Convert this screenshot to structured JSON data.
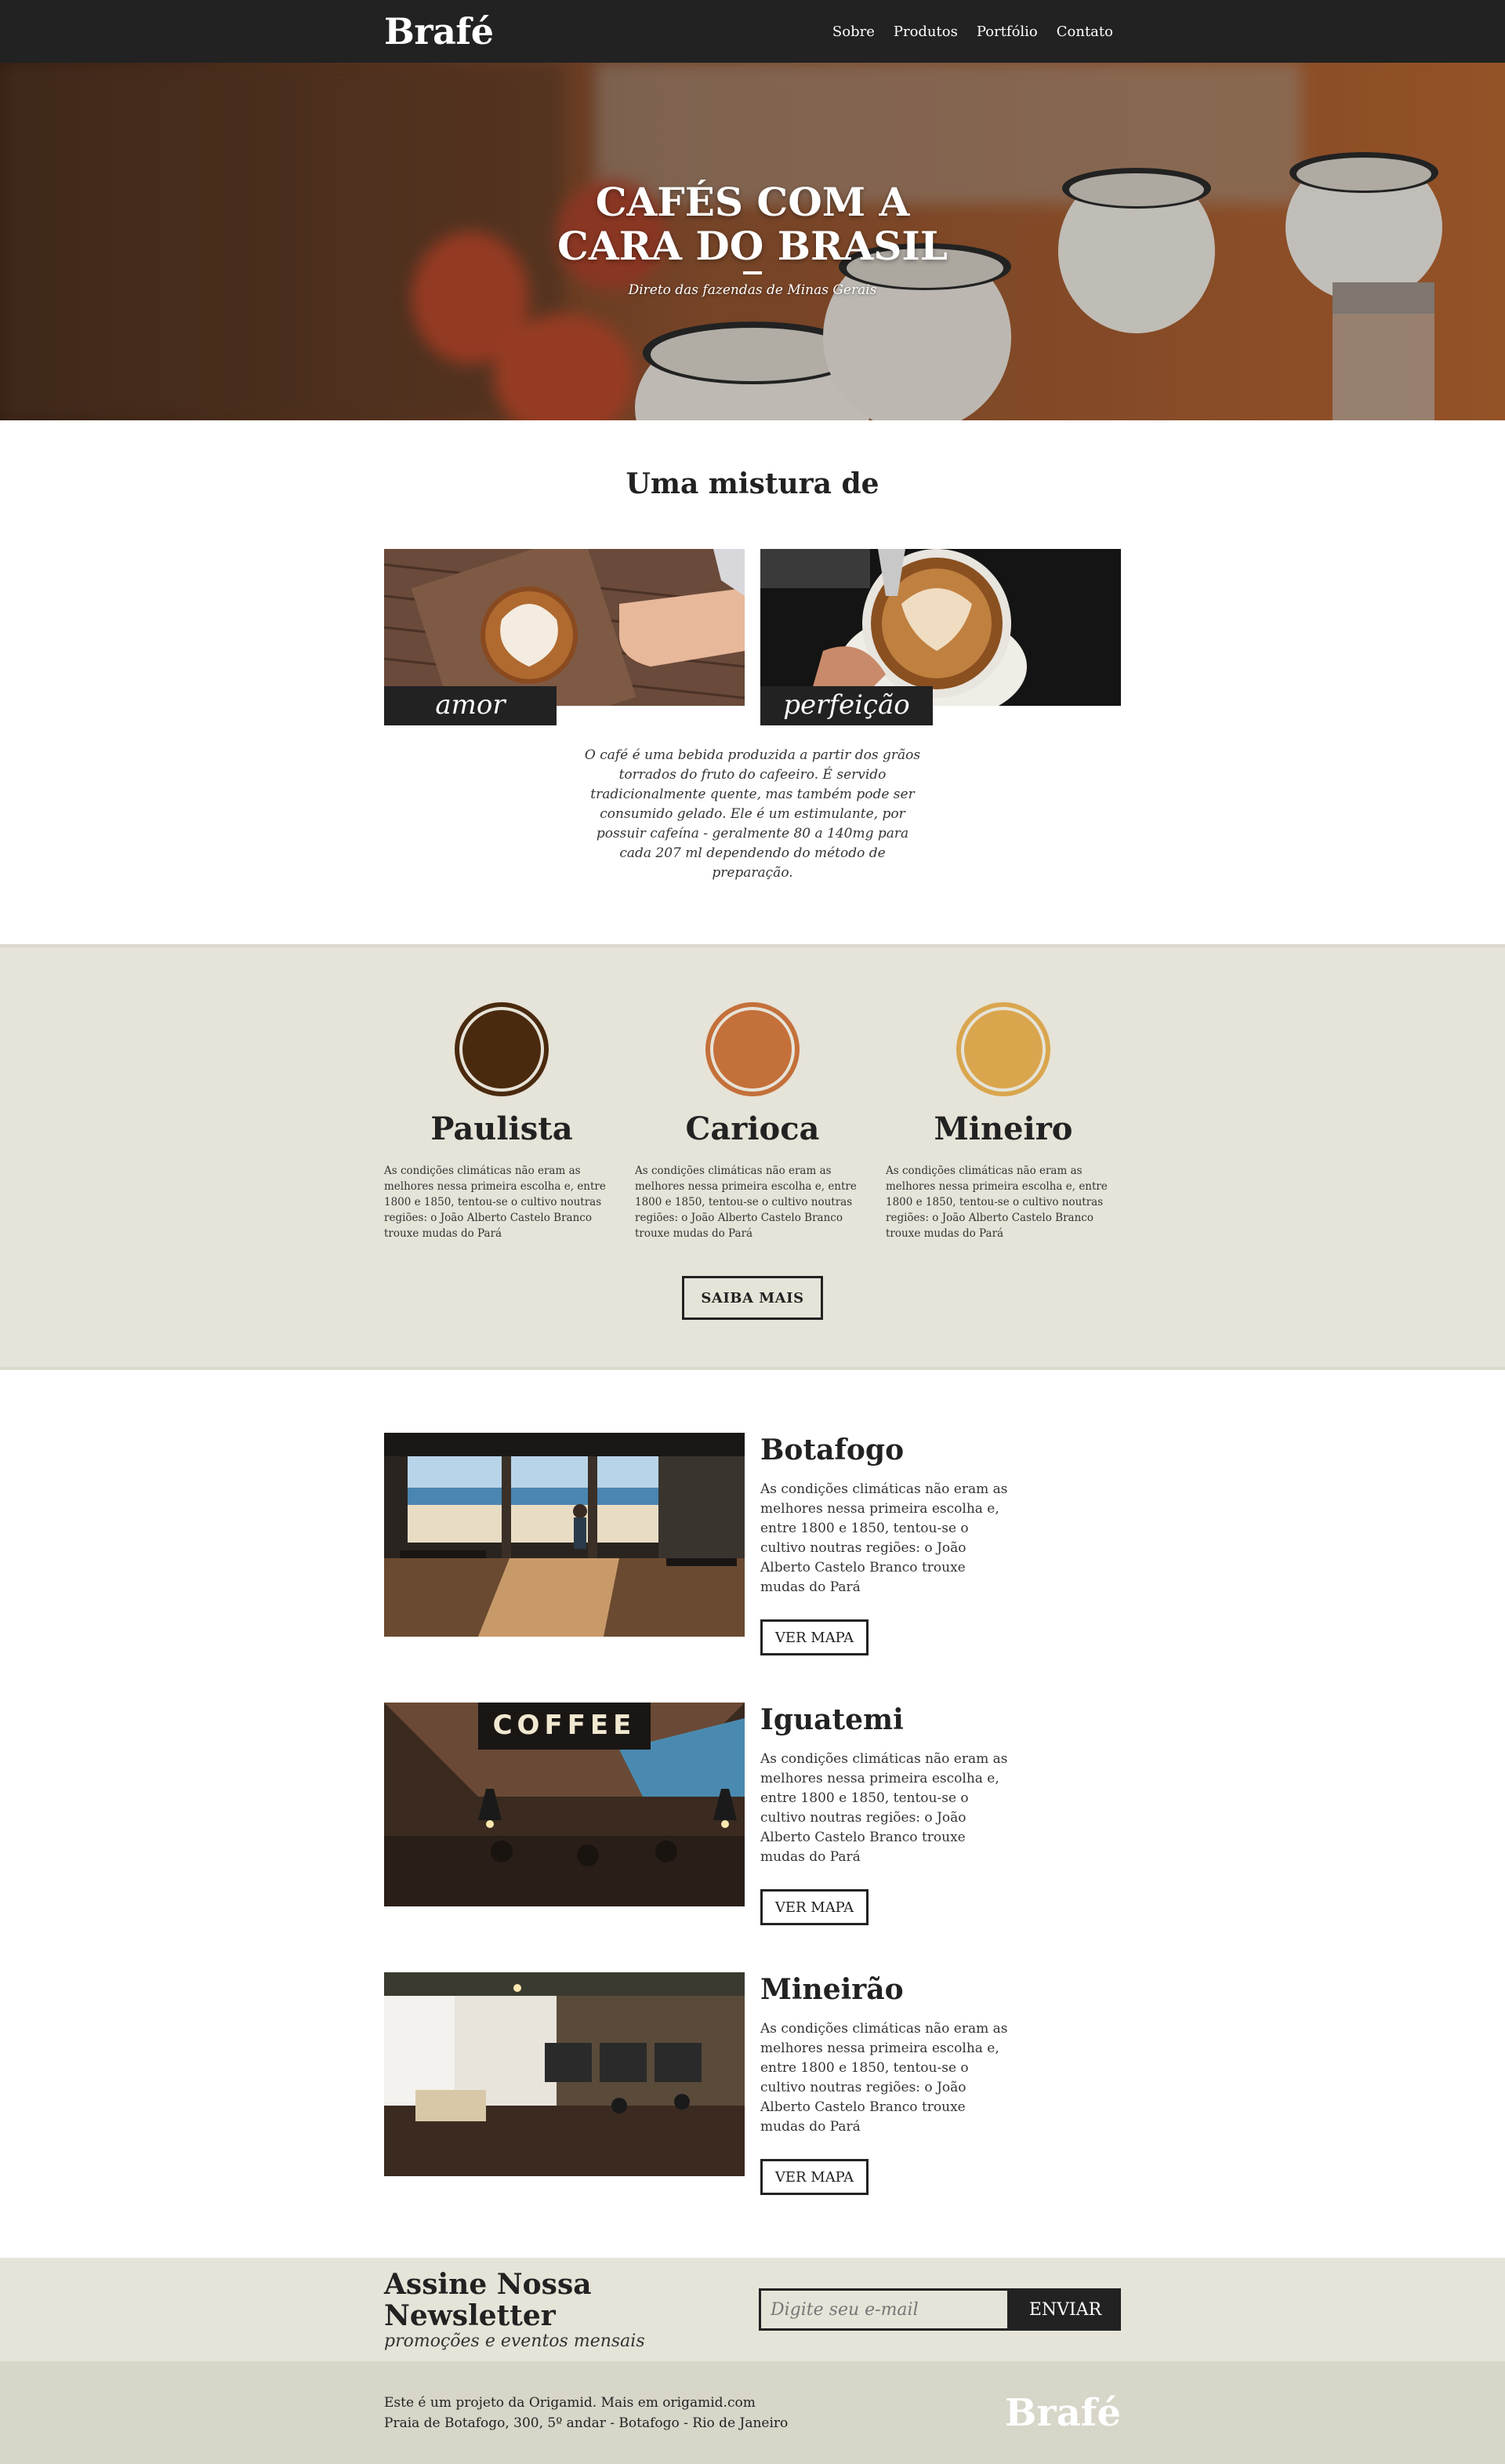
{
  "header": {
    "logo": "Brafé",
    "nav": [
      "Sobre",
      "Produtos",
      "Portfólio",
      "Contato"
    ]
  },
  "hero": {
    "title_line1": "CAFÉS COM A",
    "title_line2": "CARA DO BRASIL",
    "subtitle": "Direto das fazendas de Minas Gerais"
  },
  "mistura": {
    "title": "Uma mistura de",
    "items": [
      {
        "label": "amor"
      },
      {
        "label": "perfeição"
      }
    ],
    "text": "O café é uma bebida produzida a partir dos grãos torrados do fruto do cafeeiro. É servido tradicionalmente quente, mas também pode ser consumido gelado. Ele é um estimulante, por possuir cafeína - geralmente 80 a 140mg para cada 207 ml dependendo do método de preparação."
  },
  "types": {
    "items": [
      {
        "name": "Paulista",
        "color": "#4a2a0e",
        "text": "As condições climáticas não eram as melhores nessa primeira escolha e, entre 1800 e 1850, tentou-se o cultivo noutras regiões: o João Alberto Castelo Branco trouxe mudas do Pará"
      },
      {
        "name": "Carioca",
        "color": "#c4703a",
        "text": "As condições climáticas não eram as melhores nessa primeira escolha e, entre 1800 e 1850, tentou-se o cultivo noutras regiões: o João Alberto Castelo Branco trouxe mudas do Pará"
      },
      {
        "name": "Mineiro",
        "color": "#d9a64e",
        "text": "As condições climáticas não eram as melhores nessa primeira escolha e, entre 1800 e 1850, tentou-se o cultivo noutras regiões: o João Alberto Castelo Branco trouxe mudas do Pará"
      }
    ],
    "button": "SAIBA MAIS"
  },
  "locations": [
    {
      "name": "Botafogo",
      "text": "As condições climáticas não eram as melhores nessa primeira escolha e, entre 1800 e 1850, tentou-se o cultivo noutras regiões: o João Alberto Castelo Branco trouxe mudas do Pará",
      "button": "VER MAPA"
    },
    {
      "name": "Iguatemi",
      "text": "As condições climáticas não eram as melhores nessa primeira escolha e, entre 1800 e 1850, tentou-se o cultivo noutras regiões: o João Alberto Castelo Branco trouxe mudas do Pará",
      "button": "VER MAPA",
      "sign": "COFFEE"
    },
    {
      "name": "Mineirão",
      "text": "As condições climáticas não eram as melhores nessa primeira escolha e, entre 1800 e 1850, tentou-se o cultivo noutras regiões: o João Alberto Castelo Branco trouxe mudas do Pará",
      "button": "VER MAPA"
    }
  ],
  "newsletter": {
    "title": "Assine Nossa Newsletter",
    "subtitle": "promoções e eventos mensais",
    "placeholder": "Digite seu e-mail",
    "button": "ENVIAR"
  },
  "footer": {
    "line1": "Este é um projeto da Origamid. Mais em origamid.com",
    "line2": "Praia de Botafogo, 300, 5º andar - Botafogo - Rio de Janeiro",
    "logo": "Brafé"
  }
}
